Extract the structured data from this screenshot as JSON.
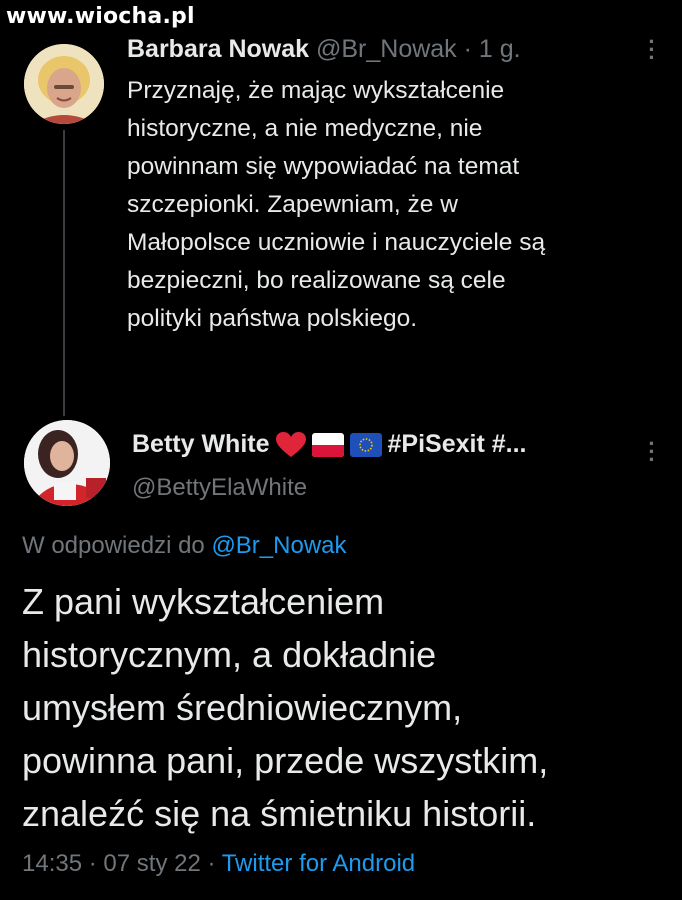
{
  "watermark": "www.wiocha.pl",
  "tweet1": {
    "author_name": "Barbara Nowak",
    "handle": "@Br_Nowak",
    "separator": "·",
    "time": "1 g.",
    "text_lines": [
      "Przyznaję, że  mając wykształcenie",
      "historyczne, a nie medyczne, nie",
      "powinnam się wypowiadać na temat",
      "szczepionki. Zapewniam, że w",
      "Małopolsce uczniowie i  nauczyciele są",
      "bezpieczni, bo realizowane są cele",
      "polityki państwa polskiego."
    ]
  },
  "tweet2": {
    "author_name": "Betty White",
    "name_suffix": "#PiSexit #...",
    "handle": "@BettyElaWhite",
    "replying_prefix": "W odpowiedzi do",
    "replying_to": "@Br_Nowak",
    "text_lines": [
      "Z pani wykształceniem",
      "historycznym, a dokładnie",
      "umysłem średniowiecznym,",
      "powinna pani, przede wszystkim,",
      "znaleźć się na śmietniku historii."
    ],
    "time": "14:35",
    "separator1": "·",
    "date": "07 sty 22",
    "separator2": "·",
    "source": "Twitter for Android"
  },
  "icons": {
    "heart": "red-heart-icon",
    "flag_pl": "poland-flag-icon",
    "flag_eu": "eu-flag-icon",
    "more": "more-options-icon"
  },
  "colors": {
    "background": "#000000",
    "text": "#e7e9ea",
    "muted": "#71767b",
    "link": "#1d9bf0"
  }
}
